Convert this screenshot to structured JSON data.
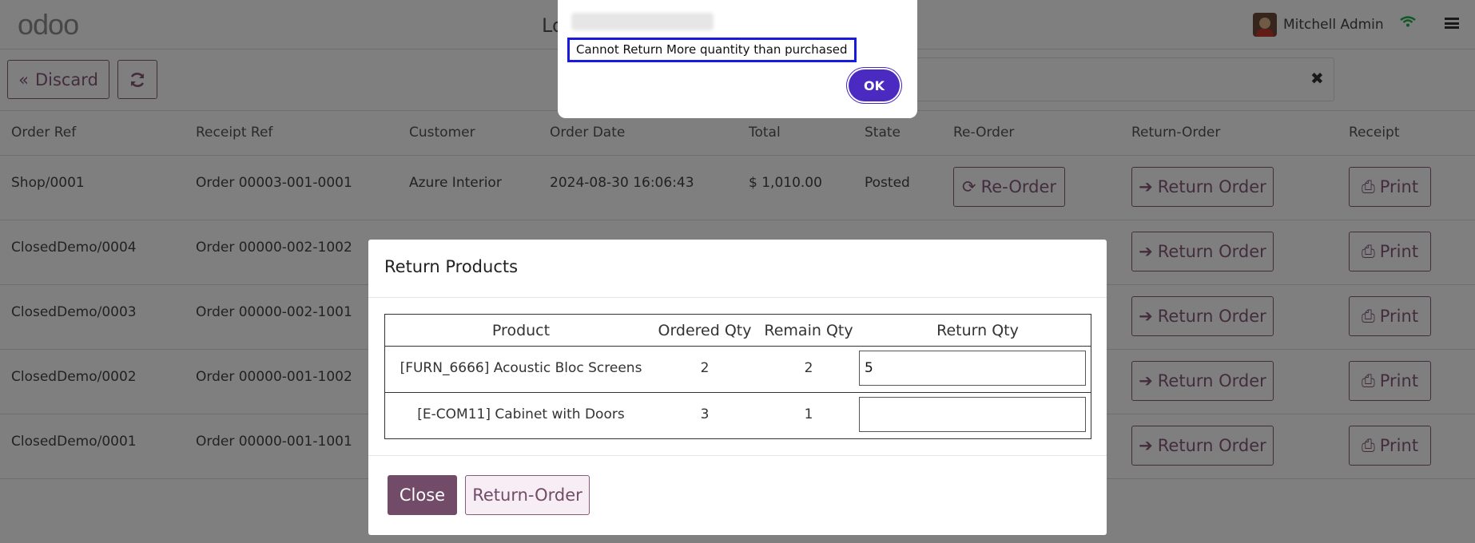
{
  "header": {
    "logo": "odoo",
    "title": "Lo",
    "user_name": "Mitchell Admin"
  },
  "controls": {
    "discard_label": "Discard",
    "search_clear": "✖"
  },
  "table": {
    "columns": [
      "Order Ref",
      "Receipt Ref",
      "Customer",
      "Order Date",
      "Total",
      "State",
      "Re-Order",
      "Return-Order",
      "Receipt"
    ],
    "rows": [
      {
        "order_ref": "Shop/0001",
        "receipt_ref": "Order 00003-001-0001",
        "customer": "Azure Interior",
        "date": "2024-08-30 16:06:43",
        "total": "$ 1,010.00",
        "state": "Posted",
        "reorder": "Re-Order",
        "return": "Return Order",
        "print": "Print"
      },
      {
        "order_ref": "ClosedDemo/0004",
        "receipt_ref": "Order 00000-002-1002",
        "customer": "",
        "date": "",
        "total": "",
        "state": "",
        "reorder": "",
        "return": "Return Order",
        "print": "Print"
      },
      {
        "order_ref": "ClosedDemo/0003",
        "receipt_ref": "Order 00000-002-1001",
        "customer": "",
        "date": "",
        "total": "",
        "state": "",
        "reorder": "",
        "return": "Return Order",
        "print": "Print"
      },
      {
        "order_ref": "ClosedDemo/0002",
        "receipt_ref": "Order 00000-001-1002",
        "customer": "",
        "date": "",
        "total": "",
        "state": "",
        "reorder": "",
        "return": "Return Order",
        "print": "Print"
      },
      {
        "order_ref": "ClosedDemo/0001",
        "receipt_ref": "Order 00000-001-1001",
        "customer": "",
        "date": "",
        "total": "",
        "state": "",
        "reorder": "",
        "return": "Return Order",
        "print": "Print"
      }
    ]
  },
  "modal": {
    "title": "Return Products",
    "columns": [
      "Product",
      "Ordered Qty",
      "Remain Qty",
      "Return Qty"
    ],
    "rows": [
      {
        "product": "[FURN_6666] Acoustic Bloc Screens",
        "ordered": "2",
        "remain": "2",
        "return_qty": "5"
      },
      {
        "product": "[E-COM11] Cabinet with Doors",
        "ordered": "3",
        "remain": "1",
        "return_qty": ""
      }
    ],
    "close_label": "Close",
    "return_label": "Return-Order"
  },
  "alert": {
    "message": "Cannot Return More quantity than purchased",
    "ok_label": "OK"
  },
  "colors": {
    "brand": "#875a7b",
    "primary": "#714b67",
    "ok_button": "#4b2ac2",
    "highlight_border": "#1a1adf"
  }
}
